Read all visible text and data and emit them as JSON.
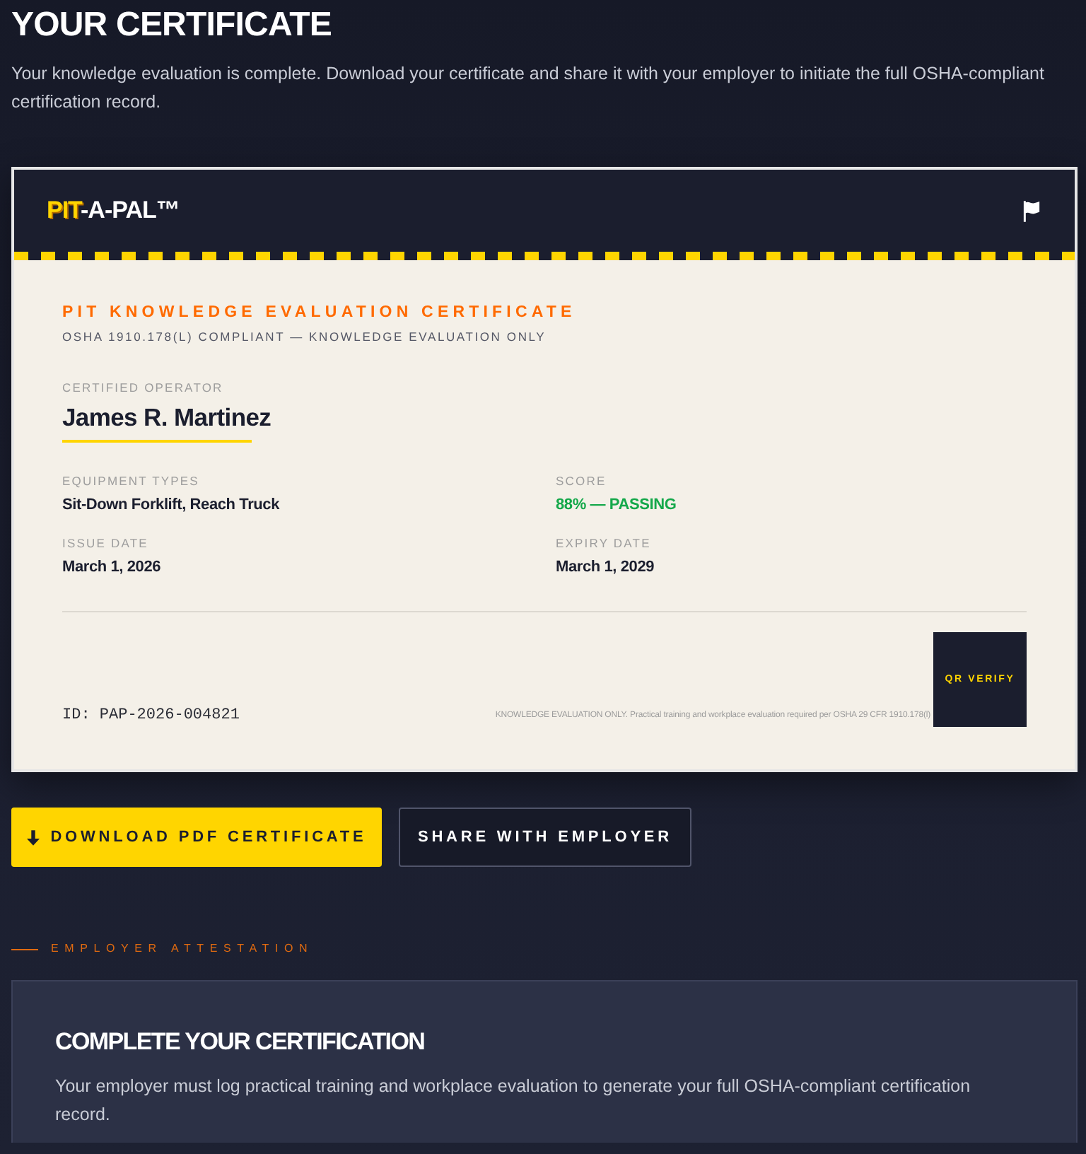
{
  "page": {
    "title": "YOUR CERTIFICATE",
    "intro": "Your knowledge evaluation is complete. Download your certificate and share it with your employer to initiate the full OSHA-compliant certification record."
  },
  "certificate": {
    "brand": {
      "accent": "PIT",
      "rest": "-A-PAL™"
    },
    "title": "PIT KNOWLEDGE EVALUATION CERTIFICATE",
    "subtitle": "OSHA 1910.178(L) COMPLIANT — KNOWLEDGE EVALUATION ONLY",
    "operator_label": "CERTIFIED OPERATOR",
    "operator_name": "James R. Martinez",
    "fields": [
      {
        "label": "EQUIPMENT TYPES",
        "value": "Sit-Down Forklift, Reach Truck",
        "kind": "plain"
      },
      {
        "label": "SCORE",
        "value": "88% — PASSING",
        "kind": "status"
      },
      {
        "label": "ISSUE DATE",
        "value": "March 1, 2026",
        "kind": "plain"
      },
      {
        "label": "EXPIRY DATE",
        "value": "March 1, 2029",
        "kind": "plain"
      }
    ],
    "id": "ID: PAP-2026-004821",
    "disclaimer": "KNOWLEDGE EVALUATION ONLY. Practical training and workplace evaluation required per OSHA 29 CFR 1910.178(l)",
    "qr_label": "QR VERIFY"
  },
  "actions": [
    {
      "label": "DOWNLOAD PDF CERTIFICATE",
      "kind": "primary"
    },
    {
      "label": "SHARE WITH EMPLOYER",
      "kind": "secondary"
    }
  ],
  "attestation": {
    "eyebrow": "EMPLOYER ATTESTATION",
    "heading": "COMPLETE YOUR CERTIFICATION",
    "body": "Your employer must log practical training and workplace evaluation to generate your full OSHA-compliant certification record."
  }
}
